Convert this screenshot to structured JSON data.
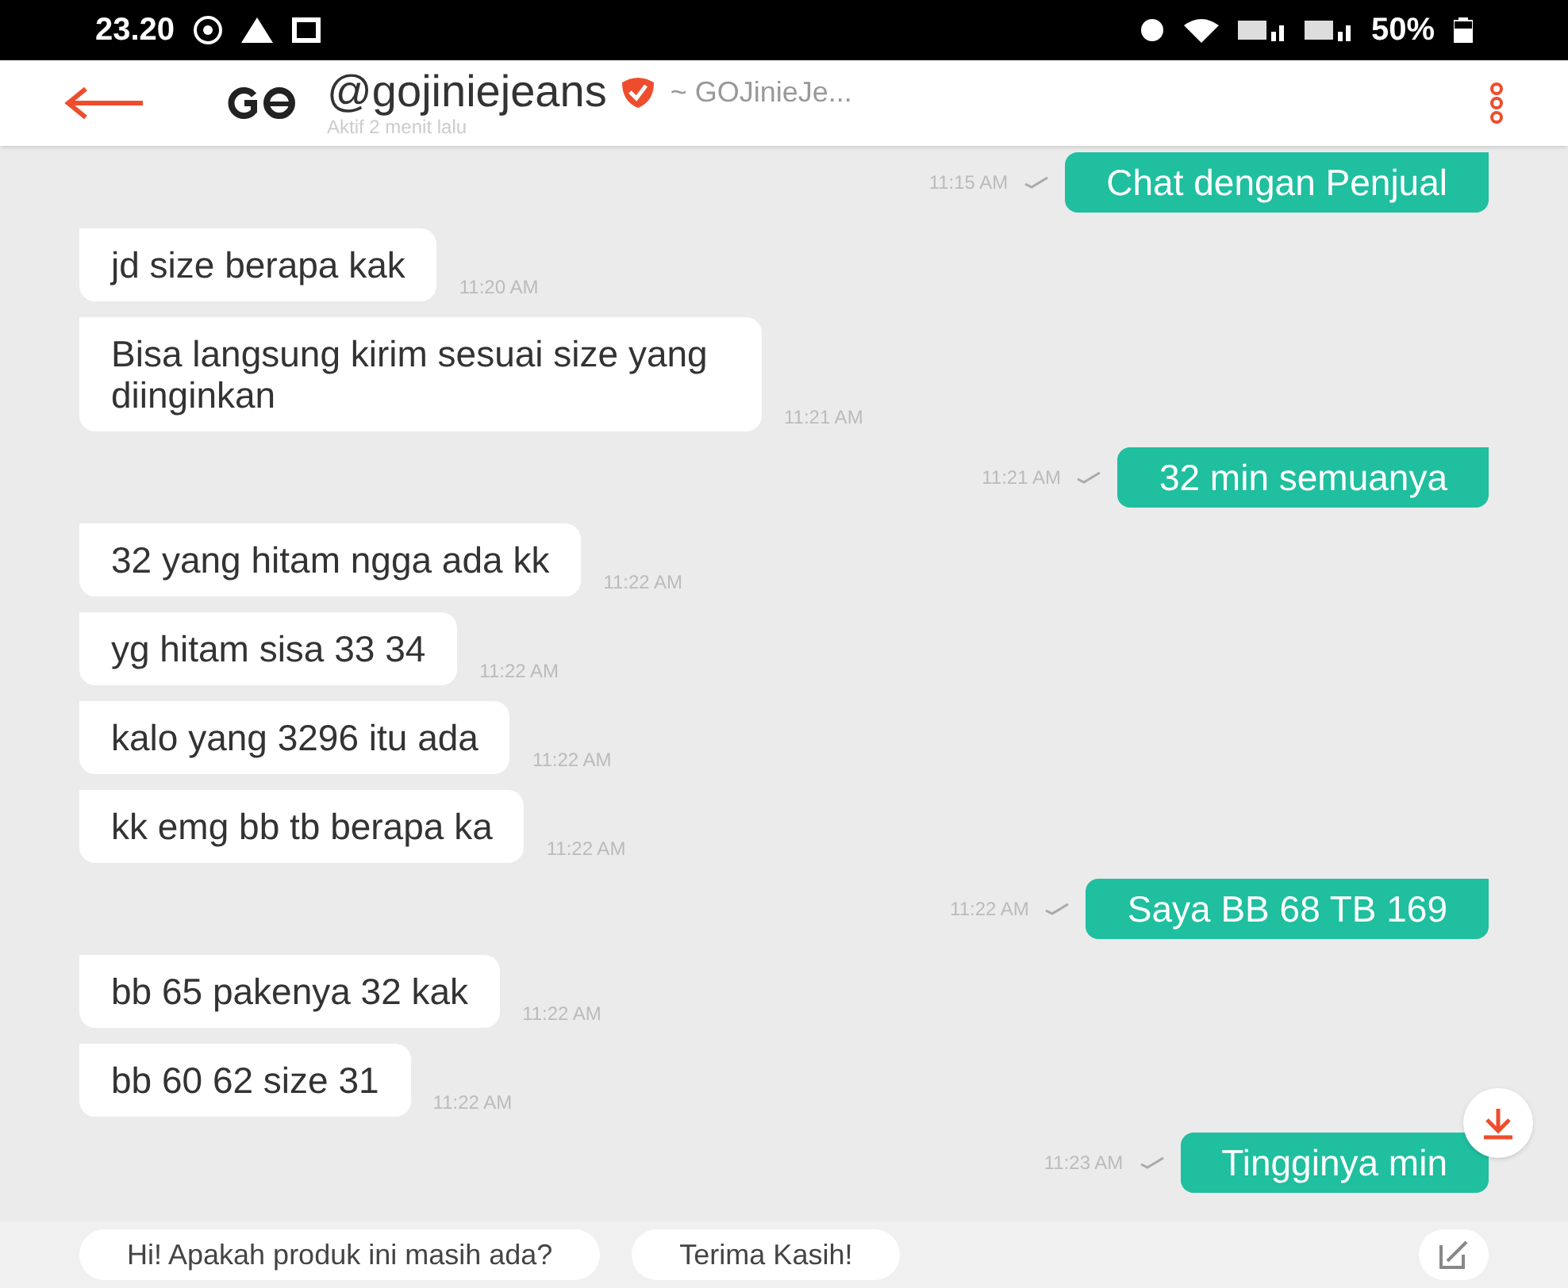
{
  "status_bar": {
    "time": "23.20",
    "battery": "50%"
  },
  "header": {
    "title": "@gojiniejeans",
    "verified": true,
    "store_name": "~ GOJinieJe...",
    "subtitle": "Aktif 2 menit lalu"
  },
  "messages": [
    {
      "kind": "outgoing",
      "text": "Chat dengan Penjual",
      "time": "11:15 AM",
      "delivered": true
    },
    {
      "kind": "incoming",
      "text": "jd size berapa kak",
      "time": "11:20 AM"
    },
    {
      "kind": "incoming",
      "text": "Bisa langsung kirim sesuai size yang diinginkan",
      "time": "11:21 AM"
    },
    {
      "kind": "outgoing",
      "text": "32 min semuanya",
      "time": "11:21 AM",
      "delivered": true
    },
    {
      "kind": "incoming",
      "text": "32 yang hitam ngga ada kk",
      "time": "11:22 AM"
    },
    {
      "kind": "incoming",
      "text": "yg hitam sisa 33 34",
      "time": "11:22 AM"
    },
    {
      "kind": "incoming",
      "text": "kalo yang 3296 itu ada",
      "time": "11:22 AM"
    },
    {
      "kind": "incoming",
      "text": "kk emg bb tb berapa ka",
      "time": "11:22 AM"
    },
    {
      "kind": "outgoing",
      "text": "Saya BB 68 TB 169",
      "time": "11:22 AM",
      "delivered": true
    },
    {
      "kind": "incoming",
      "text": "bb 65 pakenya 32 kak",
      "time": "11:22 AM"
    },
    {
      "kind": "incoming",
      "text": "bb 60 62 size 31",
      "time": "11:22 AM"
    },
    {
      "kind": "outgoing",
      "text": "Tingginya min",
      "time": "11:23 AM",
      "delivered": true
    }
  ],
  "quick_replies": [
    "Hi! Apakah produk ini masih ada?",
    "Terima Kasih!"
  ]
}
